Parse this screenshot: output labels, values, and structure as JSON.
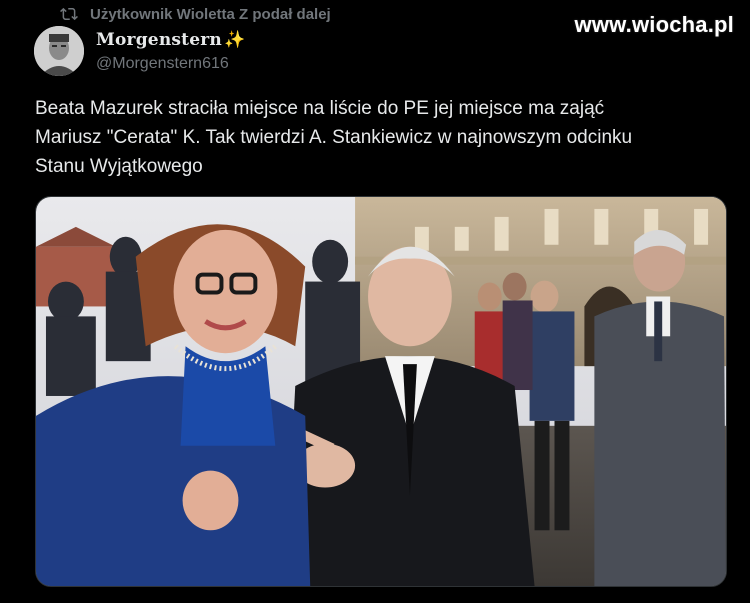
{
  "retweet": {
    "icon": "retweet-icon",
    "label": "Użytkownik Wioletta Z podał dalej"
  },
  "watermark": "www.wiocha.pl",
  "author": {
    "display_name": "Morgenstern",
    "name_emoji": "✨",
    "handle": "@Morgenstern616"
  },
  "tweet": {
    "text": "Beata Mazurek straciła miejsce na liście do PE jej miejsce ma zająć\nMariusz \"Cerata\" K. Tak twierdzi A. Stankiewicz w najnowszym odcinku\nStanu Wyjątkowego"
  },
  "colors": {
    "background": "#000000",
    "text": "#e7e9ea",
    "muted": "#71767b"
  }
}
